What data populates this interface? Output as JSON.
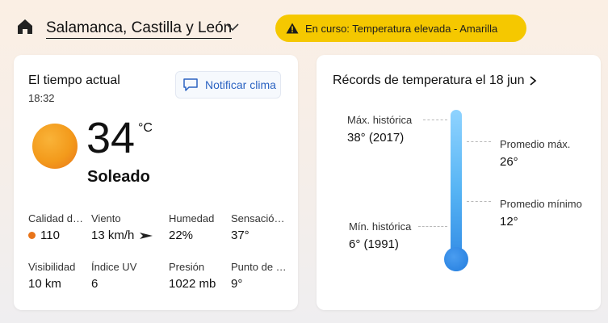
{
  "header": {
    "location": "Salamanca, Castilla y León",
    "alert": "En curso: Temperatura elevada - Amarilla"
  },
  "current": {
    "title": "El tiempo actual",
    "time": "18:32",
    "notify_label": "Notificar clima",
    "temperature": "34",
    "unit": "°C",
    "condition": "Soleado",
    "metrics": [
      {
        "label": "Calidad del aire",
        "value": "110"
      },
      {
        "label": "Viento",
        "value": "13 km/h"
      },
      {
        "label": "Humedad",
        "value": "22%"
      },
      {
        "label": "Sensación térmica",
        "value": "37°"
      },
      {
        "label": "Visibilidad",
        "value": "10 km"
      },
      {
        "label": "Índice UV",
        "value": "6"
      },
      {
        "label": "Presión",
        "value": "1022 mb"
      },
      {
        "label": "Punto de rocío",
        "value": "9°"
      }
    ]
  },
  "records": {
    "title": "Récords de temperatura el 18 jun",
    "max_hist_label": "Máx. histórica",
    "max_hist_value": "38° (2017)",
    "avg_max_label": "Promedio máx.",
    "avg_max_value": "26°",
    "avg_min_label": "Promedio mínimo",
    "avg_min_value": "12°",
    "min_hist_label": "Mín. histórica",
    "min_hist_value": "6° (1991)"
  },
  "colors": {
    "alert": "#f5c800",
    "accent": "#2b63c2",
    "sun": "#f39a1b",
    "thermometer": "#2e86e3"
  },
  "icons": {
    "home": "home-icon",
    "chevron": "chevron-down-icon",
    "alert": "warning-icon",
    "notify": "chat-icon",
    "wind": "wind-direction-icon",
    "records_chevron": "chevron-right-icon"
  }
}
